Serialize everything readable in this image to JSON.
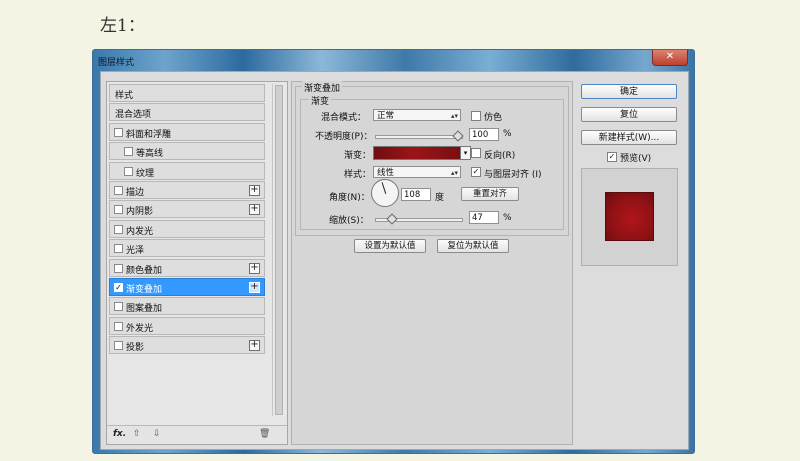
{
  "caption": "左1：",
  "dialog": {
    "title": "图层样式",
    "close_label": "✕"
  },
  "sidebar": {
    "items": [
      {
        "label": "样式",
        "checkbox": false,
        "plus": false,
        "selected": false
      },
      {
        "label": "混合选项",
        "checkbox": false,
        "plus": false,
        "selected": false
      },
      {
        "label": "斜面和浮雕",
        "checkbox": true,
        "plus": false,
        "selected": false
      },
      {
        "label": "等高线",
        "checkbox": true,
        "plus": false,
        "selected": false,
        "sub": true
      },
      {
        "label": "纹理",
        "checkbox": true,
        "plus": false,
        "selected": false,
        "sub": true
      },
      {
        "label": "描边",
        "checkbox": true,
        "plus": true,
        "selected": false
      },
      {
        "label": "内阴影",
        "checkbox": true,
        "plus": true,
        "selected": false
      },
      {
        "label": "内发光",
        "checkbox": true,
        "plus": false,
        "selected": false
      },
      {
        "label": "光泽",
        "checkbox": true,
        "plus": false,
        "selected": false
      },
      {
        "label": "颜色叠加",
        "checkbox": true,
        "plus": true,
        "selected": false
      },
      {
        "label": "渐变叠加",
        "checkbox": true,
        "plus": true,
        "selected": true
      },
      {
        "label": "图案叠加",
        "checkbox": true,
        "plus": false,
        "selected": false
      },
      {
        "label": "外发光",
        "checkbox": true,
        "plus": false,
        "selected": false
      },
      {
        "label": "投影",
        "checkbox": true,
        "plus": true,
        "selected": false
      }
    ],
    "footer": {
      "fx": "fx.",
      "up": "⇧",
      "down": "⇩",
      "trash": "🗑"
    }
  },
  "panel": {
    "section_title": "渐变叠加",
    "group_title": "渐变",
    "blend_mode_label": "混合模式：",
    "blend_mode_value": "正常",
    "dither_label": "仿色",
    "opacity_label": "不透明度(P)：",
    "opacity_value": "100",
    "opacity_unit": "%",
    "opacity_level": 1.0,
    "gradient_label": "渐变：",
    "reverse_label": "反向(R)",
    "style_label": "样式：",
    "style_value": "线性",
    "align_label": "与图层对齐 (I)",
    "angle_label": "角度(N)：",
    "angle_value": "108",
    "angle_unit": "度",
    "reset_align_label": "重置对齐",
    "scale_label": "缩放(S)：",
    "scale_value": "47",
    "scale_unit": "%",
    "scale_level": 0.47,
    "set_default_label": "设置为默认值",
    "reset_default_label": "复位为默认值"
  },
  "actions": {
    "ok_label": "确定",
    "reset_label": "复位",
    "new_style_label": "新建样式(W)...",
    "preview_label": "预览(V)"
  },
  "colors": {
    "selected": "#3399ff",
    "gradient_start": "#6f0e10",
    "gradient_end": "#9c1417"
  }
}
